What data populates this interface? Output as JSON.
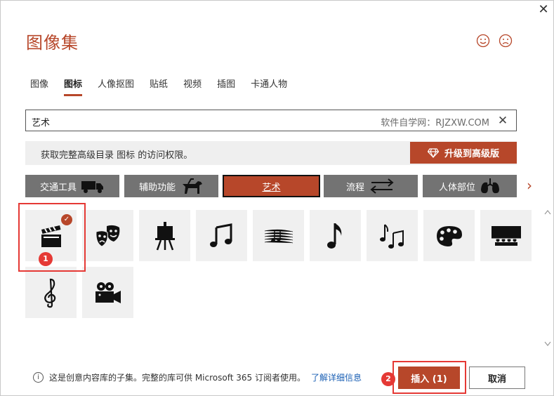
{
  "dialog": {
    "title": "图像集",
    "close_icon": "close-icon",
    "feedback": {
      "smile_icon": "smile-icon",
      "frown_icon": "frown-icon"
    }
  },
  "tabs": [
    {
      "label": "图像",
      "active": false
    },
    {
      "label": "图标",
      "active": true
    },
    {
      "label": "人像抠图",
      "active": false
    },
    {
      "label": "贴纸",
      "active": false
    },
    {
      "label": "视频",
      "active": false
    },
    {
      "label": "插图",
      "active": false
    },
    {
      "label": "卡通人物",
      "active": false
    }
  ],
  "search": {
    "value": "艺术",
    "hint": "软件自学网：RJZXW.COM"
  },
  "banner": {
    "text": "获取完整高级目录 图标 的访问权限。",
    "upgrade_label": "升级到高级版"
  },
  "categories": [
    {
      "label": "交通工具",
      "icon": "truck-icon",
      "active": false
    },
    {
      "label": "辅助功能",
      "icon": "service-dog-icon",
      "active": false
    },
    {
      "label": "艺术",
      "icon": "",
      "active": true
    },
    {
      "label": "流程",
      "icon": "arrows-icon",
      "active": false
    },
    {
      "label": "人体部位",
      "icon": "lungs-icon",
      "active": false
    }
  ],
  "icons": [
    {
      "name": "clapperboard-icon",
      "selected": true
    },
    {
      "name": "theater-masks-icon",
      "selected": false
    },
    {
      "name": "easel-icon",
      "selected": false
    },
    {
      "name": "music-notes-icon",
      "selected": false
    },
    {
      "name": "sheet-music-icon",
      "selected": false
    },
    {
      "name": "eighth-note-icon",
      "selected": false
    },
    {
      "name": "music-notes-pair-icon",
      "selected": false
    },
    {
      "name": "paint-palette-icon",
      "selected": false
    },
    {
      "name": "cinema-audience-icon",
      "selected": false
    },
    {
      "name": "treble-clef-icon",
      "selected": false
    },
    {
      "name": "movie-camera-icon",
      "selected": false
    }
  ],
  "annotations": {
    "badge1": "1",
    "badge2": "2"
  },
  "footer": {
    "info_text": "这是创意内容库的子集。完整的库可供 Microsoft 365 订阅者使用。",
    "link_text": "了解详细信息",
    "insert_label": "插入 (1)",
    "cancel_label": "取消"
  },
  "colors": {
    "accent": "#b7472a",
    "category_bg": "#737373",
    "annotation_red": "#e53935"
  }
}
